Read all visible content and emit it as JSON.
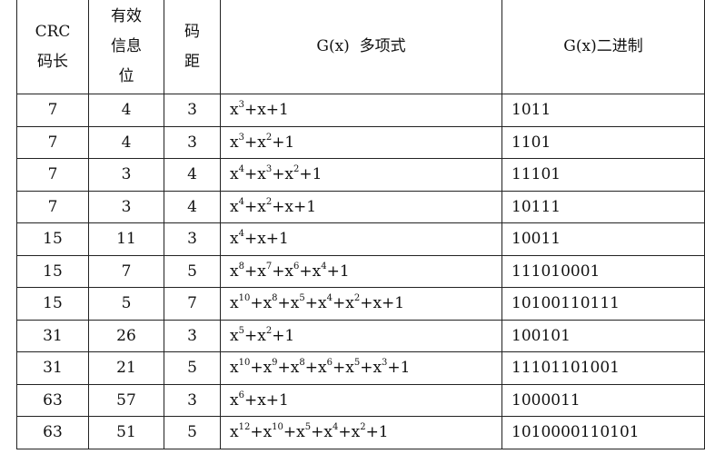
{
  "headers": {
    "crc_len": [
      "CRC",
      "码长"
    ],
    "info_bits": [
      "有效",
      "信息",
      "位"
    ],
    "distance": [
      "码",
      "距"
    ],
    "poly": "G(x)  多项式",
    "binary": "G(x)二进制"
  },
  "rows": [
    {
      "n": "7",
      "k": "4",
      "d": "3",
      "poly": [
        [
          "x",
          "3"
        ],
        [
          "+x+1",
          ""
        ]
      ],
      "bin": "1011"
    },
    {
      "n": "7",
      "k": "4",
      "d": "3",
      "poly": [
        [
          "x",
          "3"
        ],
        [
          "+x",
          "2"
        ],
        [
          "+1",
          ""
        ]
      ],
      "bin": "1101"
    },
    {
      "n": "7",
      "k": "3",
      "d": "4",
      "poly": [
        [
          "x",
          "4"
        ],
        [
          "+x",
          "3"
        ],
        [
          "+x",
          "2"
        ],
        [
          "+1",
          ""
        ]
      ],
      "bin": "11101"
    },
    {
      "n": "7",
      "k": "3",
      "d": "4",
      "poly": [
        [
          "x",
          "4"
        ],
        [
          "+x",
          "2"
        ],
        [
          "+x+1",
          ""
        ]
      ],
      "bin": "10111"
    },
    {
      "n": "15",
      "k": "11",
      "d": "3",
      "poly": [
        [
          "x",
          "4"
        ],
        [
          "+x+1",
          ""
        ]
      ],
      "bin": "10011"
    },
    {
      "n": "15",
      "k": "7",
      "d": "5",
      "poly": [
        [
          "x",
          "8"
        ],
        [
          "+x",
          "7"
        ],
        [
          "+x",
          "6"
        ],
        [
          "+x",
          "4"
        ],
        [
          "+1",
          ""
        ]
      ],
      "bin": "111010001"
    },
    {
      "n": "15",
      "k": "5",
      "d": "7",
      "poly": [
        [
          "x",
          "10"
        ],
        [
          "+x",
          "8"
        ],
        [
          "+x",
          "5"
        ],
        [
          "+x",
          "4"
        ],
        [
          "+x",
          "2"
        ],
        [
          "+x+1",
          ""
        ]
      ],
      "bin": "10100110111"
    },
    {
      "n": "31",
      "k": "26",
      "d": "3",
      "poly": [
        [
          "x",
          "5"
        ],
        [
          "+x",
          "2"
        ],
        [
          "+1",
          ""
        ]
      ],
      "bin": "100101"
    },
    {
      "n": "31",
      "k": "21",
      "d": "5",
      "poly": [
        [
          "x",
          "10"
        ],
        [
          "+x",
          "9"
        ],
        [
          "+x",
          "8"
        ],
        [
          "+x",
          "6"
        ],
        [
          "+x",
          "5"
        ],
        [
          "+x",
          "3"
        ],
        [
          "+1",
          ""
        ]
      ],
      "bin": "11101101001"
    },
    {
      "n": "63",
      "k": "57",
      "d": "3",
      "poly": [
        [
          "x",
          "6"
        ],
        [
          "+x+1",
          ""
        ]
      ],
      "bin": "1000011"
    },
    {
      "n": "63",
      "k": "51",
      "d": "5",
      "poly": [
        [
          "x",
          "12"
        ],
        [
          "+x",
          "10"
        ],
        [
          "+x",
          "5"
        ],
        [
          "+x",
          "4"
        ],
        [
          "+x",
          "2"
        ],
        [
          "+1",
          ""
        ]
      ],
      "bin": "1010000110101"
    }
  ]
}
